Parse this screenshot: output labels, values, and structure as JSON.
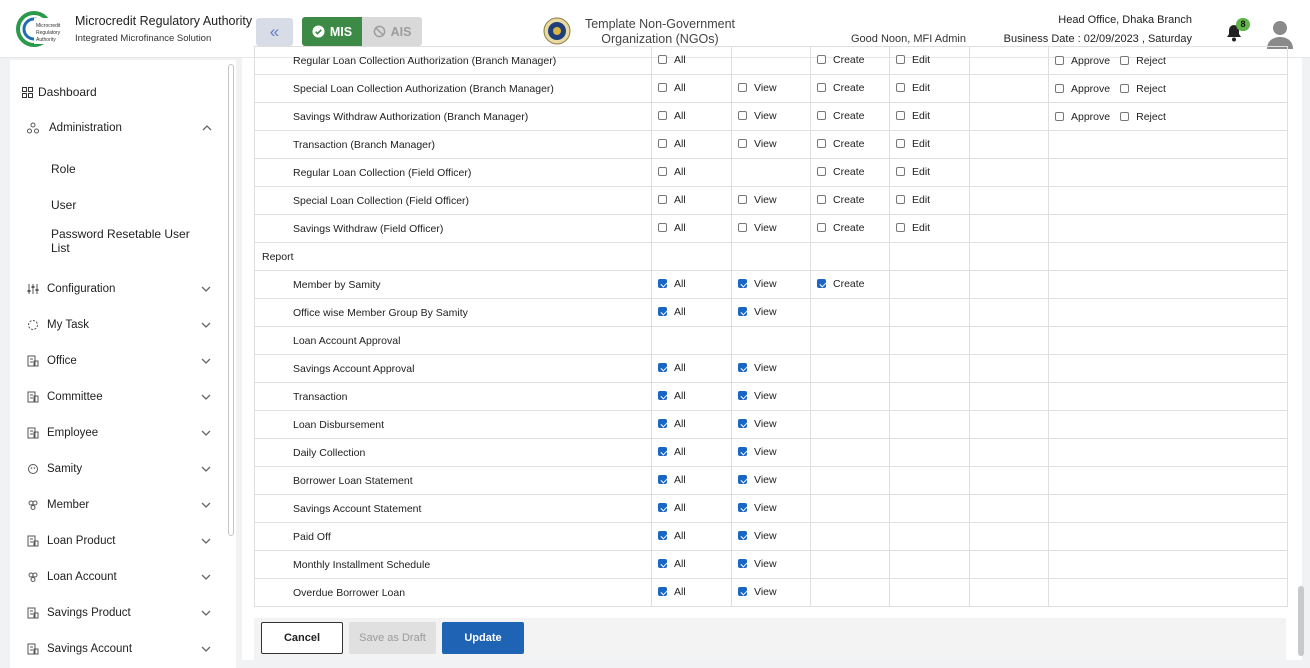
{
  "header": {
    "brand_title": "Microcredit Regulatory Authority",
    "brand_subtitle": "Integrated Microfinance Solution",
    "logo_text": "Microcredit Regulatory Authority",
    "mode_mis": "MIS",
    "mode_ais": "AIS",
    "org_name": "Template Non-Government Organization (NGOs)",
    "greeting": "Good Noon, MFI Admin",
    "branch": "Head Office, Dhaka Branch",
    "business_date": "Business Date : 02/09/2023 , Saturday",
    "notification_count": "8",
    "accent_color": "#3c8a46"
  },
  "sidebar": {
    "dashboard": "Dashboard",
    "administration": "Administration",
    "sub_items": [
      "Role",
      "User",
      "Password Resetable User List"
    ],
    "items": [
      {
        "label": "Configuration",
        "icon": "sliders-icon"
      },
      {
        "label": "My Task",
        "icon": "task-icon"
      },
      {
        "label": "Office",
        "icon": "office-icon"
      },
      {
        "label": "Committee",
        "icon": "committee-icon"
      },
      {
        "label": "Employee",
        "icon": "employee-icon"
      },
      {
        "label": "Samity",
        "icon": "samity-icon"
      },
      {
        "label": "Member",
        "icon": "member-icon"
      },
      {
        "label": "Loan Product",
        "icon": "loan-product-icon"
      },
      {
        "label": "Loan Account",
        "icon": "loan-account-icon"
      },
      {
        "label": "Savings Product",
        "icon": "savings-product-icon"
      },
      {
        "label": "Savings Account",
        "icon": "savings-account-icon"
      }
    ]
  },
  "labels": {
    "all": "All",
    "view": "View",
    "create": "Create",
    "edit": "Edit",
    "approve": "Approve",
    "reject": "Reject"
  },
  "rows": [
    {
      "name": "Regular Loan Collection Authorization (Branch Manager)",
      "all": false,
      "view": null,
      "create": false,
      "edit": false,
      "approve": false,
      "reject": false
    },
    {
      "name": "Special Loan Collection Authorization (Branch Manager)",
      "all": false,
      "view": false,
      "create": false,
      "edit": false,
      "approve": false,
      "reject": false
    },
    {
      "name": "Savings Withdraw Authorization (Branch Manager)",
      "all": false,
      "view": false,
      "create": false,
      "edit": false,
      "approve": false,
      "reject": false
    },
    {
      "name": "Transaction (Branch Manager)",
      "all": false,
      "view": false,
      "create": false,
      "edit": false
    },
    {
      "name": "Regular Loan Collection (Field Officer)",
      "all": false,
      "view": null,
      "create": false,
      "edit": false
    },
    {
      "name": "Special Loan Collection (Field Officer)",
      "all": false,
      "view": false,
      "create": false,
      "edit": false
    },
    {
      "name": "Savings Withdraw (Field Officer)",
      "all": false,
      "view": false,
      "create": false,
      "edit": false
    },
    {
      "section": "Report"
    },
    {
      "name": "Member by Samity",
      "all": true,
      "view": true,
      "create": true
    },
    {
      "name": "Office wise Member Group By Samity",
      "all": true,
      "view": true
    },
    {
      "name": "Loan Account Approval"
    },
    {
      "name": "Savings Account Approval",
      "all": true,
      "view": true
    },
    {
      "name": "Transaction",
      "all": true,
      "view": true
    },
    {
      "name": "Loan Disbursement",
      "all": true,
      "view": true
    },
    {
      "name": "Daily Collection",
      "all": true,
      "view": true
    },
    {
      "name": "Borrower Loan Statement",
      "all": true,
      "view": true
    },
    {
      "name": "Savings Account Statement",
      "all": true,
      "view": true
    },
    {
      "name": "Paid Off",
      "all": true,
      "view": true
    },
    {
      "name": "Monthly Installment Schedule",
      "all": true,
      "view": true
    },
    {
      "name": "Overdue Borrower Loan",
      "all": true,
      "view": true
    }
  ],
  "buttons": {
    "cancel": "Cancel",
    "save_draft": "Save as Draft",
    "update": "Update"
  }
}
